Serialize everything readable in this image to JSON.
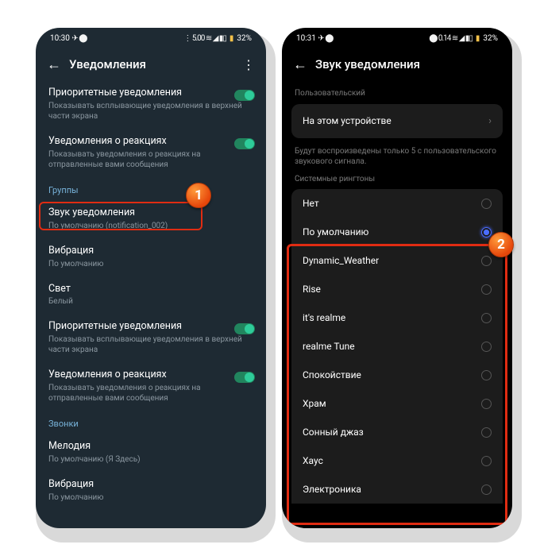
{
  "colors": {
    "highlight": "#e02c12",
    "toggle": "#2ecc9a",
    "badge": "#e6470b"
  },
  "badges": {
    "b1": "1",
    "b2": "2"
  },
  "phone1": {
    "status": {
      "time": "10:30",
      "battery": "32%",
      "icons_left": "✈ ⬤",
      "icons_right": "⋮ 5.00 ≋ ◢ ▮▯"
    },
    "header": {
      "title": "Уведомления"
    },
    "rows": {
      "priority": {
        "t": "Приоритетные уведомления",
        "s": "Показывать всплывающие уведомления в верхней части экрана"
      },
      "reactions": {
        "t": "Уведомления о реакциях",
        "s": "Показывать уведомления о реакциях на отправленные вами сообщения"
      },
      "sect_groups": "Группы",
      "sound": {
        "t": "Звук уведомления",
        "s": "По умолчанию (notification_002)"
      },
      "vibro": {
        "t": "Вибрация",
        "s": "По умолчанию"
      },
      "light": {
        "t": "Свет",
        "s": "Белый"
      },
      "priority2": {
        "t": "Приоритетные уведомления",
        "s": "Показывать всплывающие уведомления в верхней части экрана"
      },
      "reactions2": {
        "t": "Уведомления о реакциях",
        "s": "Показывать уведомления о реакциях на отправленные вами сообщения"
      },
      "sect_calls": "Звонки",
      "melody": {
        "t": "Мелодия",
        "s": "По умолчанию (Я Здесь)"
      },
      "vibro2": {
        "t": "Вибрация",
        "s": "По умолчанию"
      }
    }
  },
  "phone2": {
    "status": {
      "time": "10:31",
      "battery": "32%",
      "icons_left": "✈ ⬤",
      "icons_right": "⬤ 0.14 ≋ ◢ ▮▯"
    },
    "header": {
      "title": "Звук уведомления"
    },
    "custom_label": "Пользовательский",
    "device_row": "На этом устройстве",
    "note": "Будут воспроизведены только 5 с пользовательского звукового сигнала.",
    "system_label": "Системные рингтоны",
    "ringtones": [
      {
        "name": "Нет",
        "selected": false
      },
      {
        "name": "По умолчанию",
        "selected": true
      },
      {
        "name": "Dynamic_Weather",
        "selected": false
      },
      {
        "name": "Rise",
        "selected": false
      },
      {
        "name": "it's realme",
        "selected": false
      },
      {
        "name": "realme Tune",
        "selected": false
      },
      {
        "name": "Спокойствие",
        "selected": false
      },
      {
        "name": "Храм",
        "selected": false
      },
      {
        "name": "Сонный джаз",
        "selected": false
      },
      {
        "name": "Хаус",
        "selected": false
      },
      {
        "name": "Электроника",
        "selected": false
      }
    ]
  }
}
